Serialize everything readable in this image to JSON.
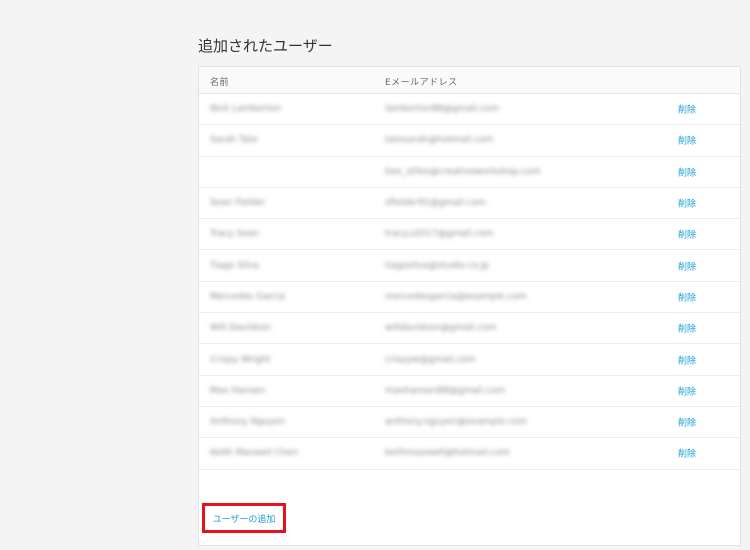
{
  "section": {
    "title": "追加されたユーザー"
  },
  "table": {
    "headers": {
      "name": "名前",
      "email": "Eメールアドレス"
    },
    "rows": [
      {
        "name": "Nick Lamberton",
        "email": "lamberton88@gmail.com",
        "action": "削除"
      },
      {
        "name": "Sarah Tate",
        "email": "tatesarah@hotmail.com",
        "action": "削除"
      },
      {
        "name": "",
        "email": "bee_stiles@creativeworkshop.com",
        "action": "削除"
      },
      {
        "name": "Sean Fielder",
        "email": "sfielder91@gmail.com",
        "action": "削除"
      },
      {
        "name": "Tracy Sean",
        "email": "tracy.s2017@gmail.com",
        "action": "削除"
      },
      {
        "name": "Tiago Silva",
        "email": "tiagosilva@studio.co.jp",
        "action": "削除"
      },
      {
        "name": "Mercedes Garcia",
        "email": "mercedesgarcia@example.com",
        "action": "削除"
      },
      {
        "name": "Will Davidson",
        "email": "willdavidson@gmail.com",
        "action": "削除"
      },
      {
        "name": "Crispy Wright",
        "email": "crispyw@gmail.com",
        "action": "削除"
      },
      {
        "name": "Max Hansen",
        "email": "maxhansen88@gmail.com",
        "action": "削除"
      },
      {
        "name": "Anthony Nguyen",
        "email": "anthony.nguyen@example.com",
        "action": "削除"
      },
      {
        "name": "Keith Maxwell Chen",
        "email": "keithmaxwell@hotmail.com",
        "action": "削除"
      }
    ]
  },
  "footer": {
    "add_user_label": "ユーザーの追加"
  },
  "colors": {
    "link": "#1a9fd6",
    "highlight": "#e3141d"
  }
}
